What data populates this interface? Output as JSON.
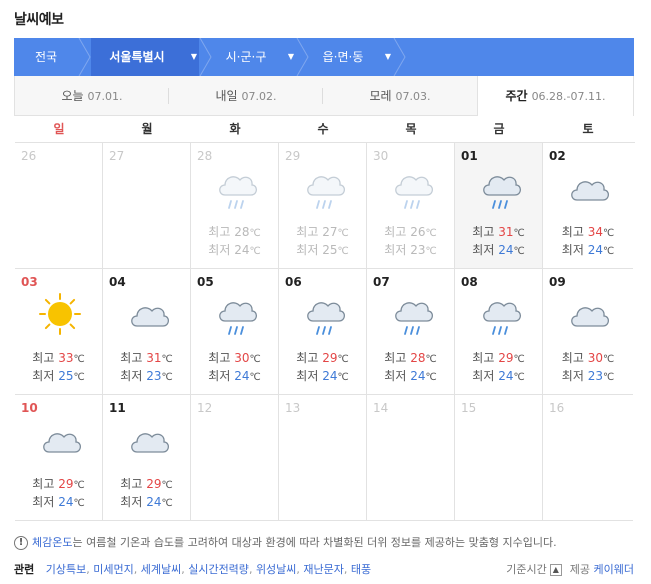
{
  "title": "날씨예보",
  "location": {
    "items": [
      {
        "label": "전국"
      },
      {
        "label": "서울특별시"
      },
      {
        "label": "시·군·구"
      },
      {
        "label": "읍·면·동"
      }
    ]
  },
  "day_tabs": [
    {
      "label": "오늘",
      "date": "07.01."
    },
    {
      "label": "내일",
      "date": "07.02."
    },
    {
      "label": "모레",
      "date": "07.03."
    },
    {
      "label": "주간",
      "date": "06.28.-07.11."
    }
  ],
  "weekdays": [
    "일",
    "월",
    "화",
    "수",
    "목",
    "금",
    "토"
  ],
  "temp_labels": {
    "high": "최고",
    "low": "최저",
    "unit": "℃"
  },
  "weeks": [
    [
      {
        "date": "26",
        "state": "past",
        "icon": "none"
      },
      {
        "date": "27",
        "state": "past",
        "icon": "none"
      },
      {
        "date": "28",
        "state": "past",
        "icon": "rain-cloud-icon",
        "high": "28",
        "low": "24"
      },
      {
        "date": "29",
        "state": "past",
        "icon": "rain-cloud-icon",
        "high": "27",
        "low": "25"
      },
      {
        "date": "30",
        "state": "past",
        "icon": "rain-cloud-icon",
        "high": "26",
        "low": "23"
      },
      {
        "date": "01",
        "state": "today",
        "icon": "rain-cloud-icon",
        "high": "31",
        "low": "24"
      },
      {
        "date": "02",
        "state": "normal",
        "icon": "cloud-icon",
        "high": "34",
        "low": "24"
      }
    ],
    [
      {
        "date": "03",
        "state": "normal",
        "icon": "sun-icon",
        "high": "33",
        "low": "25"
      },
      {
        "date": "04",
        "state": "normal",
        "icon": "cloud-icon",
        "high": "31",
        "low": "23"
      },
      {
        "date": "05",
        "state": "normal",
        "icon": "rain-cloud-icon",
        "high": "30",
        "low": "24"
      },
      {
        "date": "06",
        "state": "normal",
        "icon": "rain-cloud-icon",
        "high": "29",
        "low": "24"
      },
      {
        "date": "07",
        "state": "normal",
        "icon": "rain-cloud-icon",
        "high": "28",
        "low": "24"
      },
      {
        "date": "08",
        "state": "normal",
        "icon": "rain-cloud-icon",
        "high": "29",
        "low": "24"
      },
      {
        "date": "09",
        "state": "normal",
        "icon": "cloud-icon",
        "high": "30",
        "low": "23"
      }
    ],
    [
      {
        "date": "10",
        "state": "normal",
        "icon": "cloud-icon",
        "high": "29",
        "low": "24"
      },
      {
        "date": "11",
        "state": "normal",
        "icon": "cloud-icon",
        "high": "29",
        "low": "24"
      },
      {
        "date": "12",
        "state": "future",
        "icon": "none"
      },
      {
        "date": "13",
        "state": "future",
        "icon": "none"
      },
      {
        "date": "14",
        "state": "future",
        "icon": "none"
      },
      {
        "date": "15",
        "state": "future",
        "icon": "none"
      },
      {
        "date": "16",
        "state": "future",
        "icon": "none"
      }
    ]
  ],
  "notice": {
    "term": "체감온도",
    "text": "는 여름철 기온과 습도를 고려하여 대상과 환경에 따라 차별화된 더위 정보를 제공하는 맞춤형 지수입니다."
  },
  "related": {
    "label": "관련",
    "links": [
      "기상특보",
      "미세먼지",
      "세계날씨",
      "실시간전력량",
      "위성날씨",
      "재난문자",
      "태풍"
    ]
  },
  "footer": {
    "base_time": "기준시간",
    "provider_label": "제공",
    "provider": "케이웨더"
  },
  "colors": {
    "accent": "#4f87ea",
    "high_temp": "#e34646",
    "low_temp": "#3f7ad6",
    "sunday": "#e05555"
  }
}
